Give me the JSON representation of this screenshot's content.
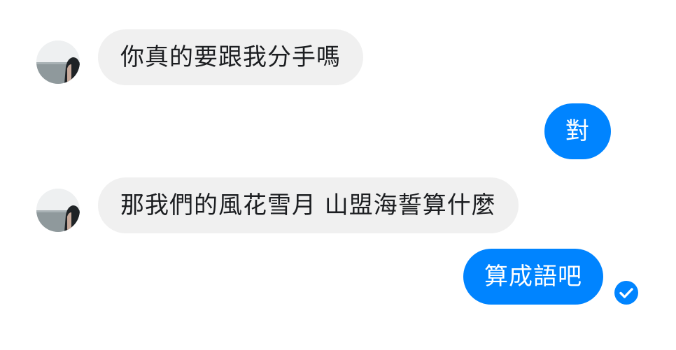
{
  "conversation": {
    "messages": [
      {
        "sender": "other",
        "text": "你真的要跟我分手嗎"
      },
      {
        "sender": "me",
        "text": "對"
      },
      {
        "sender": "other",
        "text": "那我們的風花雪月 山盟海誓算什麼"
      },
      {
        "sender": "me",
        "text": "算成語吧"
      }
    ],
    "read_receipt_icon": "checkmark-circle-icon"
  },
  "colors": {
    "incoming_bubble": "#f0f0f0",
    "outgoing_bubble": "#0084ff",
    "incoming_text": "#1c1e21",
    "outgoing_text": "#ffffff"
  }
}
